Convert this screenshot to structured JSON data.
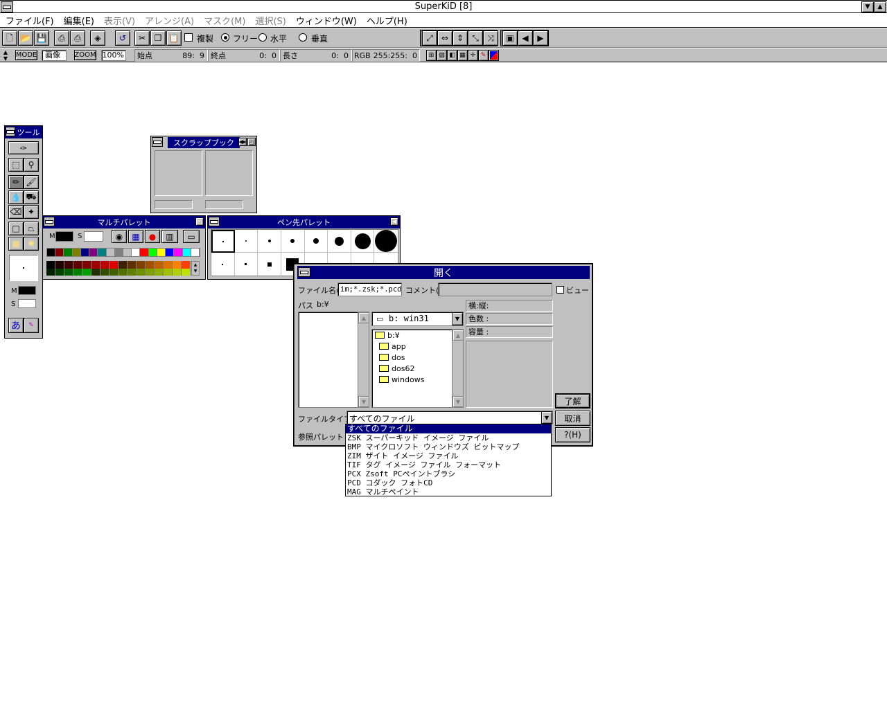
{
  "app": {
    "title": "SuperKiD [8]"
  },
  "menu": [
    {
      "label": "ファイル(F)",
      "enabled": true
    },
    {
      "label": "編集(E)",
      "enabled": true
    },
    {
      "label": "表示(V)",
      "enabled": false
    },
    {
      "label": "アレンジ(A)",
      "enabled": false
    },
    {
      "label": "マスク(M)",
      "enabled": false
    },
    {
      "label": "選択(S)",
      "enabled": false
    },
    {
      "label": "ウィンドウ(W)",
      "enabled": true
    },
    {
      "label": "ヘルプ(H)",
      "enabled": true
    }
  ],
  "toolbar": {
    "copy_checkbox_label": "複製",
    "radio_free": "フリー",
    "radio_horizontal": "水平",
    "radio_vertical": "垂直"
  },
  "status": {
    "mode_label": "MODE",
    "mode_value": "画像",
    "zoom_label": "ZOOM",
    "zoom_value": "100%",
    "start_label": "始点",
    "start_value": "89:  9",
    "end_label": "終点",
    "end_value": "0:  0",
    "length_label": "長さ",
    "length_value": "0:  0",
    "rgb_label": "RGB",
    "rgb_value": "255:255:  0"
  },
  "tool_panel": {
    "title": "ツール",
    "m_label": "M",
    "s_label": "S"
  },
  "scrapbook": {
    "title": "スクラップブック"
  },
  "multipalette": {
    "title": "マルチパレット",
    "m_label": "M",
    "s_label": "S"
  },
  "pen_palette": {
    "title": "ペン先パレット"
  },
  "open_dialog": {
    "title": "開く",
    "filename_label": "ファイル名(N)",
    "filename_value": "im;*.zsk;*.pcd",
    "comment_label": "コメント(C)",
    "comment_value": "",
    "view_label": "ビュー",
    "path_label": "パス",
    "path_value": "b:¥",
    "drive_value": "b: win31",
    "dirs": [
      "b:¥",
      "app",
      "dos",
      "dos62",
      "windows"
    ],
    "info_size_label": "横:縦:",
    "info_colors_label": "色数 :",
    "info_capacity_label": "容量 :",
    "ok_button": "了解",
    "cancel_button": "取消",
    "help_button": "?(H)",
    "filetype_label": "ファイルタイプ(T)",
    "filetype_value": "すべてのファイル",
    "ref_palette_label": "参照パレット",
    "filetype_options": [
      "すべてのファイル",
      "ZSK スーパーキッド イメージ ファイル",
      "BMP マイクロソフト ウィンドウズ ビットマップ",
      "ZIM ザイト イメージ ファイル",
      "TIF タグ イメージ ファイル フォーマット",
      "PCX Zsoft PCペイントブラシ",
      "PCD コダック フォトCD",
      "MAG マルチペイント"
    ]
  },
  "palette_colors_row1": [
    "#000000",
    "#800000",
    "#008000",
    "#808000",
    "#000080",
    "#800080",
    "#008080",
    "#c0c0c0",
    "#808080",
    "#c0c0c0",
    "#ffffff",
    "#ff0000",
    "#00ff00",
    "#ffff00",
    "#0000ff",
    "#ff00ff",
    "#00ffff",
    "#ffffff"
  ],
  "palette_colors_row2": [
    "#000000",
    "#200000",
    "#400000",
    "#600000",
    "#800000",
    "#a00000",
    "#c00000",
    "#e00000",
    "#402000",
    "#603000",
    "#804000",
    "#a05000",
    "#c06000",
    "#e07000",
    "#ff8000",
    "#ff4000"
  ],
  "palette_colors_row3": [
    "#002000",
    "#004000",
    "#006000",
    "#008000",
    "#00a000",
    "#203000",
    "#305000",
    "#406000",
    "#507000",
    "#608000",
    "#709000",
    "#80a000",
    "#90b000",
    "#a0c000",
    "#b0d000",
    "#c0e000"
  ]
}
